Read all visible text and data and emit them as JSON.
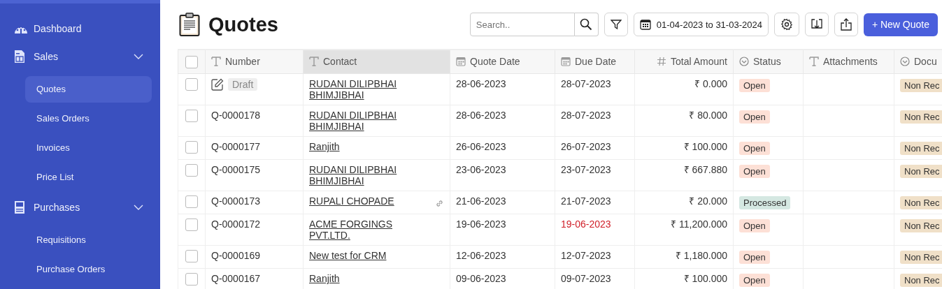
{
  "sidebar": {
    "items": [
      {
        "label": "Dashboard"
      },
      {
        "label": "Sales",
        "expanded": true,
        "children": [
          {
            "label": "Quotes",
            "selected": true
          },
          {
            "label": "Sales Orders",
            "selected": false
          },
          {
            "label": "Invoices",
            "selected": false
          },
          {
            "label": "Price List",
            "selected": false
          }
        ]
      },
      {
        "label": "Purchases",
        "expanded": true,
        "children": [
          {
            "label": "Requisitions",
            "selected": false
          },
          {
            "label": "Purchase Orders",
            "selected": false
          }
        ]
      }
    ]
  },
  "page": {
    "title": "Quotes"
  },
  "toolbar": {
    "search": {
      "placeholder": "Search.."
    },
    "date_range": "01-04-2023 to 31-03-2024",
    "new_button": "+ New Quote"
  },
  "table": {
    "all_checked": false,
    "columns": [
      {
        "label": "Number",
        "kind": "text",
        "highlighted": false
      },
      {
        "label": "Contact",
        "kind": "text",
        "highlighted": true
      },
      {
        "label": "Quote Date",
        "kind": "date",
        "highlighted": false
      },
      {
        "label": "Due Date",
        "kind": "date",
        "highlighted": false
      },
      {
        "label": "Total Amount",
        "kind": "number",
        "highlighted": false
      },
      {
        "label": "Status",
        "kind": "status",
        "highlighted": false
      },
      {
        "label": "Attachments",
        "kind": "text",
        "highlighted": false
      },
      {
        "label": "Docu",
        "kind": "status",
        "highlighted": false
      }
    ],
    "rows": [
      {
        "checked": false,
        "kind": "draft",
        "number": "Draft",
        "contact": "RUDANI DILIPBHAI BHIMJIBHAI",
        "linked": false,
        "quote_date": "28-06-2023",
        "due_date": "28-07-2023",
        "overdue": false,
        "amount": "₹ 0.000",
        "status": {
          "label": "Open",
          "color": "#fde0d6"
        },
        "document": {
          "label": "Non Rec",
          "color": "#f0e0c8"
        }
      },
      {
        "checked": false,
        "kind": "quote",
        "number": "Q-0000178",
        "contact": "RUDANI DILIPBHAI BHIMJIBHAI",
        "linked": false,
        "quote_date": "28-06-2023",
        "due_date": "28-07-2023",
        "overdue": false,
        "amount": "₹ 80.000",
        "status": {
          "label": "Open",
          "color": "#fde0d6"
        },
        "document": {
          "label": "Non Rec",
          "color": "#f0e0c8"
        }
      },
      {
        "checked": false,
        "kind": "quote",
        "number": "Q-0000177",
        "contact": "Ranjith",
        "linked": false,
        "quote_date": "26-06-2023",
        "due_date": "26-07-2023",
        "overdue": false,
        "amount": "₹ 100.000",
        "status": {
          "label": "Open",
          "color": "#fde0d6"
        },
        "document": {
          "label": "Non Rec",
          "color": "#f0e0c8"
        }
      },
      {
        "checked": false,
        "kind": "quote",
        "number": "Q-0000175",
        "contact": "RUDANI DILIPBHAI BHIMJIBHAI",
        "linked": false,
        "quote_date": "23-06-2023",
        "due_date": "23-07-2023",
        "overdue": false,
        "amount": "₹ 667.880",
        "status": {
          "label": "Open",
          "color": "#fde0d6"
        },
        "document": {
          "label": "Non Rec",
          "color": "#f0e0c8"
        }
      },
      {
        "checked": false,
        "kind": "quote",
        "number": "Q-0000173",
        "contact": "RUPALI CHOPADE",
        "linked": true,
        "quote_date": "21-06-2023",
        "due_date": "21-07-2023",
        "overdue": false,
        "amount": "₹ 20.000",
        "status": {
          "label": "Processed",
          "color": "#d5e8e2"
        },
        "document": {
          "label": "Non Rec",
          "color": "#f0e0c8"
        }
      },
      {
        "checked": false,
        "kind": "quote",
        "number": "Q-0000172",
        "contact": "ACME FORGINGS PVT.LTD.",
        "linked": false,
        "quote_date": "19-06-2023",
        "due_date": "19-06-2023",
        "overdue": true,
        "amount": "₹ 11,200.000",
        "status": {
          "label": "Open",
          "color": "#fde0d6"
        },
        "document": {
          "label": "Non Rec",
          "color": "#f0e0c8"
        }
      },
      {
        "checked": false,
        "kind": "quote",
        "number": "Q-0000169",
        "contact": "New test for CRM",
        "linked": false,
        "quote_date": "12-06-2023",
        "due_date": "12-07-2023",
        "overdue": false,
        "amount": "₹ 1,180.000",
        "status": {
          "label": "Open",
          "color": "#fde0d6"
        },
        "document": {
          "label": "Non Rec",
          "color": "#f0e0c8"
        }
      },
      {
        "checked": false,
        "kind": "quote",
        "number": "Q-0000167",
        "contact": "Ranjith",
        "linked": false,
        "quote_date": "09-06-2023",
        "due_date": "09-07-2023",
        "overdue": false,
        "amount": "₹ 100.000",
        "status": {
          "label": "Open",
          "color": "#fde0d6"
        },
        "document": {
          "label": "Non Rec",
          "color": "#f0e0c8"
        }
      }
    ]
  }
}
